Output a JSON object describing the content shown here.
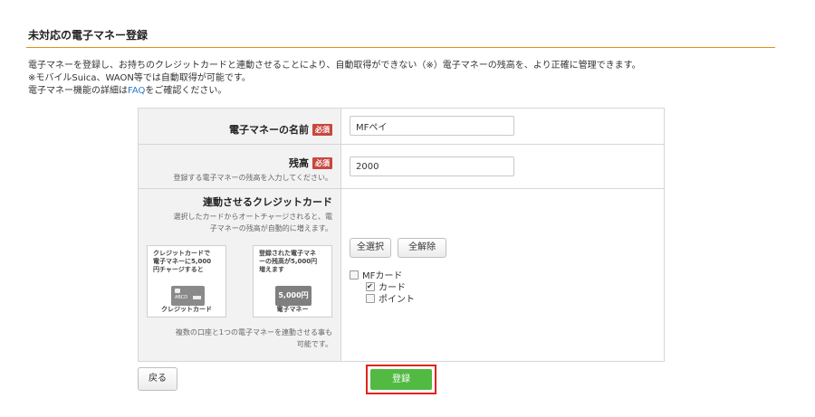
{
  "page": {
    "title": "未対応の電子マネー登録",
    "desc_lines": [
      "電子マネーを登録し、お持ちのクレジットカードと連動させることにより、自動取得ができない（※）電子マネーの残高を、より正確に管理できます。",
      "※モバイルSuica、WAON等では自動取得が可能です。"
    ],
    "desc_faq_prefix": "電子マネー機能の詳細は",
    "desc_faq_link": "FAQ",
    "desc_faq_suffix": "をご確認ください。"
  },
  "form": {
    "name_label": "電子マネーの名前",
    "required_badge": "必須",
    "name_value": "MFペイ",
    "balance_label": "残高",
    "balance_help": "登録する電子マネーの残高を入力してください。",
    "balance_value": "2000",
    "card_label": "連動させるクレジットカード",
    "card_help_1": "選択したカードからオートチャージされると、電",
    "card_help_2": "子マネーの残高が自動的に増えます。",
    "flow_left_text": [
      "クレジットカードで",
      "電子マネーに5,000",
      "円チャージすると"
    ],
    "flow_left_caption": "クレジットカード",
    "flow_left_card_text": "ABCD",
    "flow_right_text": [
      "登録された電子マネ",
      "ーの残高が5,000円",
      "増えます"
    ],
    "flow_right_caption": "電子マネー",
    "flow_right_amount": "5,000円",
    "note_1": "複数の口座と1つの電子マネーを連動させる事も",
    "note_2": "可能です。",
    "select_all": "全選択",
    "deselect_all": "全解除",
    "accounts": [
      {
        "label": "MFカード",
        "checked": false
      },
      {
        "label": "カード",
        "checked": true
      },
      {
        "label": "ポイント",
        "checked": false
      }
    ]
  },
  "actions": {
    "back_label": "戻る",
    "submit_label": "登録"
  },
  "colors": {
    "accent_rule": "#e8891e",
    "required": "#c9473f",
    "submit": "#52ba43",
    "highlight": "#e0241b",
    "link": "#2a7ac7"
  }
}
